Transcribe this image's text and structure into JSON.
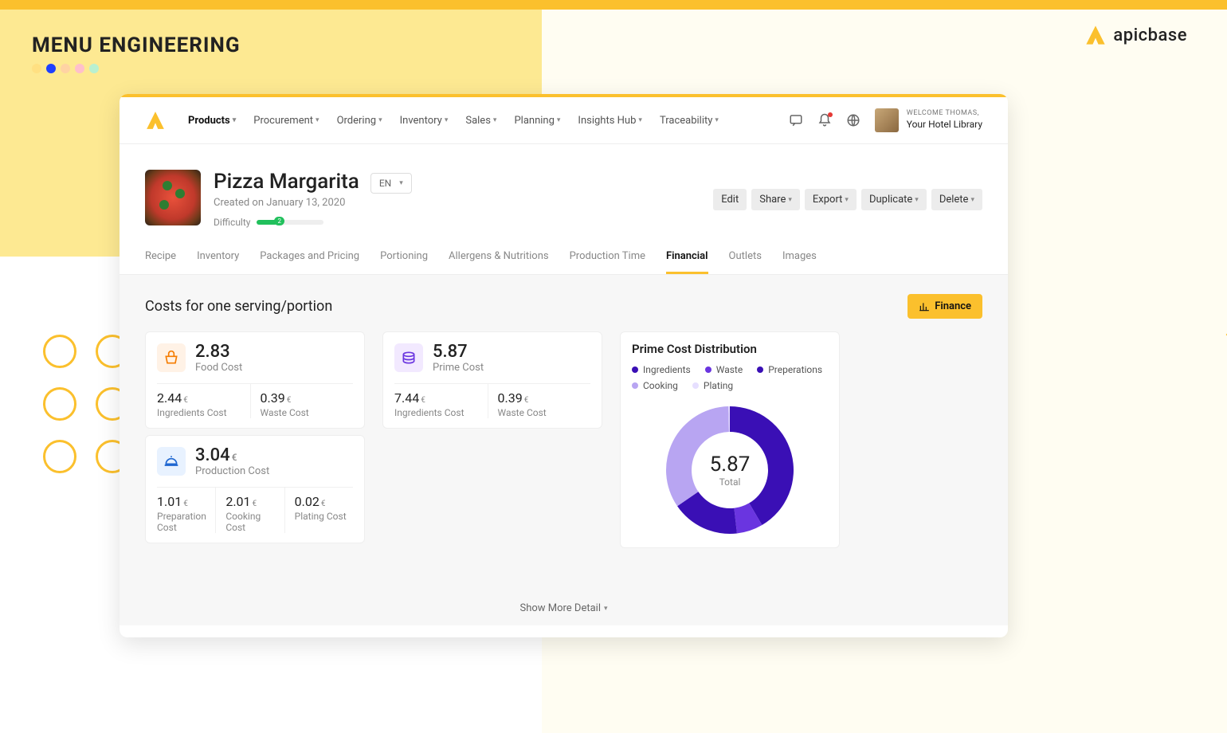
{
  "page": {
    "title": "MENU ENGINEERING",
    "brand": "apicbase"
  },
  "header": {
    "nav": [
      {
        "label": "Products",
        "active": true
      },
      {
        "label": "Procurement"
      },
      {
        "label": "Ordering"
      },
      {
        "label": "Inventory"
      },
      {
        "label": "Sales"
      },
      {
        "label": "Planning"
      },
      {
        "label": "Insights Hub"
      },
      {
        "label": "Traceability"
      }
    ],
    "welcome": "WELCOME THOMAS,",
    "library": "Your Hotel Library"
  },
  "recipe": {
    "title": "Pizza Margarita",
    "created": "Created on January 13, 2020",
    "difficulty_label": "Difficulty",
    "difficulty_value": "2",
    "lang": "EN"
  },
  "actions": {
    "edit": "Edit",
    "share": "Share",
    "export": "Export",
    "duplicate": "Duplicate",
    "delete": "Delete"
  },
  "tabs": [
    "Recipe",
    "Inventory",
    "Packages and Pricing",
    "Portioning",
    "Allergens & Nutritions",
    "Production Time",
    "Financial",
    "Outlets",
    "Images"
  ],
  "active_tab": "Financial",
  "content": {
    "title": "Costs for one serving/portion",
    "finance_btn": "Finance",
    "food": {
      "value": "2.83",
      "label": "Food Cost",
      "sub1_val": "2.44",
      "sub1_cur": "€",
      "sub1_lbl": "Ingredients Cost",
      "sub2_val": "0.39",
      "sub2_cur": "€",
      "sub2_lbl": "Waste Cost"
    },
    "prod": {
      "value": "3.04",
      "cur": "€",
      "label": "Production Cost",
      "sub1_val": "1.01",
      "sub1_cur": "€",
      "sub1_lbl": "Preparation Cost",
      "sub2_val": "2.01",
      "sub2_cur": "€",
      "sub2_lbl": "Cooking Cost",
      "sub3_val": "0.02",
      "sub3_cur": "€",
      "sub3_lbl": "Plating Cost"
    },
    "prime": {
      "value": "5.87",
      "label": "Prime Cost",
      "sub1_val": "7.44",
      "sub1_cur": "€",
      "sub1_lbl": "Ingredients Cost",
      "sub2_val": "0.39",
      "sub2_cur": "€",
      "sub2_lbl": "Waste Cost"
    },
    "donut": {
      "title": "Prime Cost Distribution",
      "total": "5.87",
      "total_label": "Total",
      "legend": [
        {
          "label": "Ingredients",
          "color": "#3a0fb5"
        },
        {
          "label": "Waste",
          "color": "#6a35e0"
        },
        {
          "label": "Preperations",
          "color": "#3a0fb5"
        },
        {
          "label": "Cooking",
          "color": "#b8a5f2"
        },
        {
          "label": "Plating",
          "color": "#e6dfff"
        }
      ]
    },
    "show_more": "Show More Detail"
  },
  "chart_data": {
    "type": "pie",
    "title": "Prime Cost Distribution",
    "series": [
      {
        "name": "Ingredients",
        "value": 2.44,
        "color": "#3a0fb5"
      },
      {
        "name": "Waste",
        "value": 0.39,
        "color": "#6a35e0"
      },
      {
        "name": "Preperations",
        "value": 1.01,
        "color": "#3a0fb5"
      },
      {
        "name": "Cooking",
        "value": 2.01,
        "color": "#b8a5f2"
      },
      {
        "name": "Plating",
        "value": 0.02,
        "color": "#e6dfff"
      }
    ],
    "total": 5.87
  }
}
